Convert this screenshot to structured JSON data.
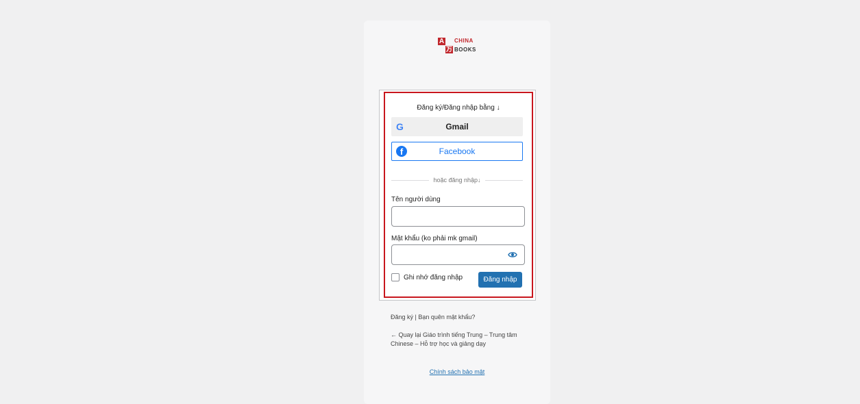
{
  "logo": {
    "top": "CHINA",
    "bottom": "BOOKS",
    "mark1": "A",
    "mark2": "万"
  },
  "social": {
    "title": "Đăng ký/Đăng nhập bằng ↓",
    "gmail_icon": "G",
    "gmail_label": "Gmail",
    "facebook_icon": "f",
    "facebook_label": "Facebook"
  },
  "divider_text": "hoặc đăng nhập↓",
  "form": {
    "username_label": "Tên người dùng",
    "username_value": "",
    "password_label": "Mật khẩu (ko phải mk gmail)",
    "password_value": "",
    "remember_label": "Ghi nhớ đăng nhập",
    "submit_label": "Đăng nhập"
  },
  "nav": {
    "register": "Đăng ký",
    "separator": " | ",
    "lost_password": "Bạn quên mật khẩu?",
    "back": "← Quay lại Giáo trình tiếng Trung – Trung tâm Chinese – Hỗ trợ học và giảng dạy"
  },
  "privacy": "Chính sách bảo mật",
  "colors": {
    "accent": "#2271b1",
    "facebook": "#1877f2",
    "highlight": "#c8161d",
    "brand": "#c1272d"
  },
  "icons": [
    "google-icon",
    "facebook-icon",
    "eye-icon"
  ]
}
